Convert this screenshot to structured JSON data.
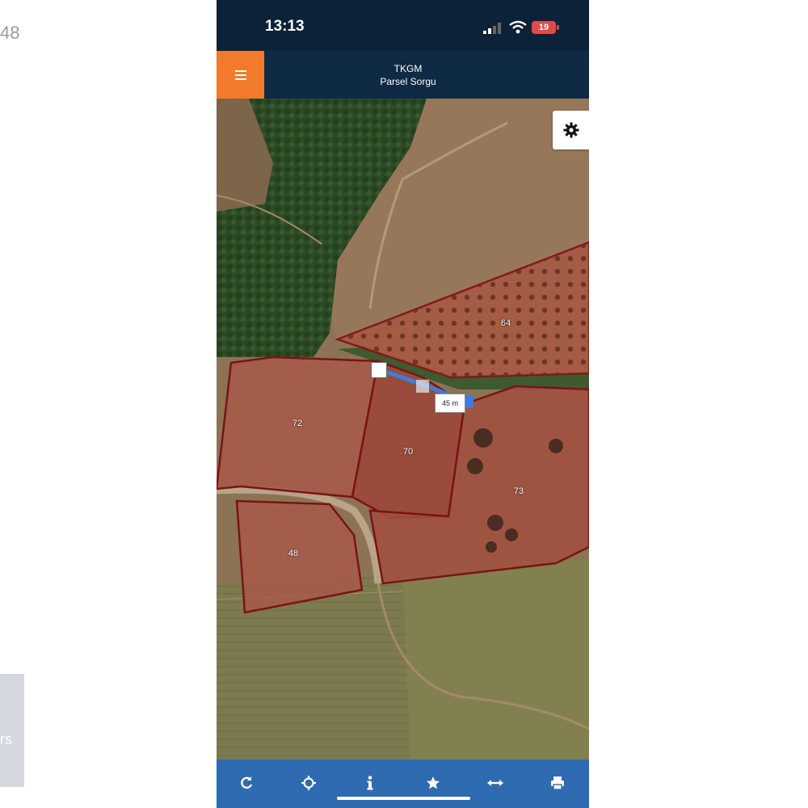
{
  "background": {
    "top_left_text": "48",
    "side_card_text": "rs"
  },
  "status_bar": {
    "time": "13:13",
    "battery": "19"
  },
  "header": {
    "title": "TKGM",
    "subtitle": "Parsel Sorgu"
  },
  "map": {
    "parcels": [
      {
        "label": "64"
      },
      {
        "label": "72"
      },
      {
        "label": "70"
      },
      {
        "label": "73"
      },
      {
        "label": "48"
      }
    ],
    "measurement": "45 m",
    "parcel_border_color": "#7a1414",
    "parcel_fill_color": "#b0413a",
    "measure_line_color": "#3b7ee0"
  },
  "toolbar": {
    "icons": [
      "refresh-icon",
      "locate-icon",
      "info-icon",
      "star-icon",
      "measure-icon",
      "print-icon"
    ]
  },
  "colors": {
    "accent_orange": "#f37a2a",
    "header_navy": "#0e2a44",
    "toolbar_blue": "#2f6bb0"
  }
}
